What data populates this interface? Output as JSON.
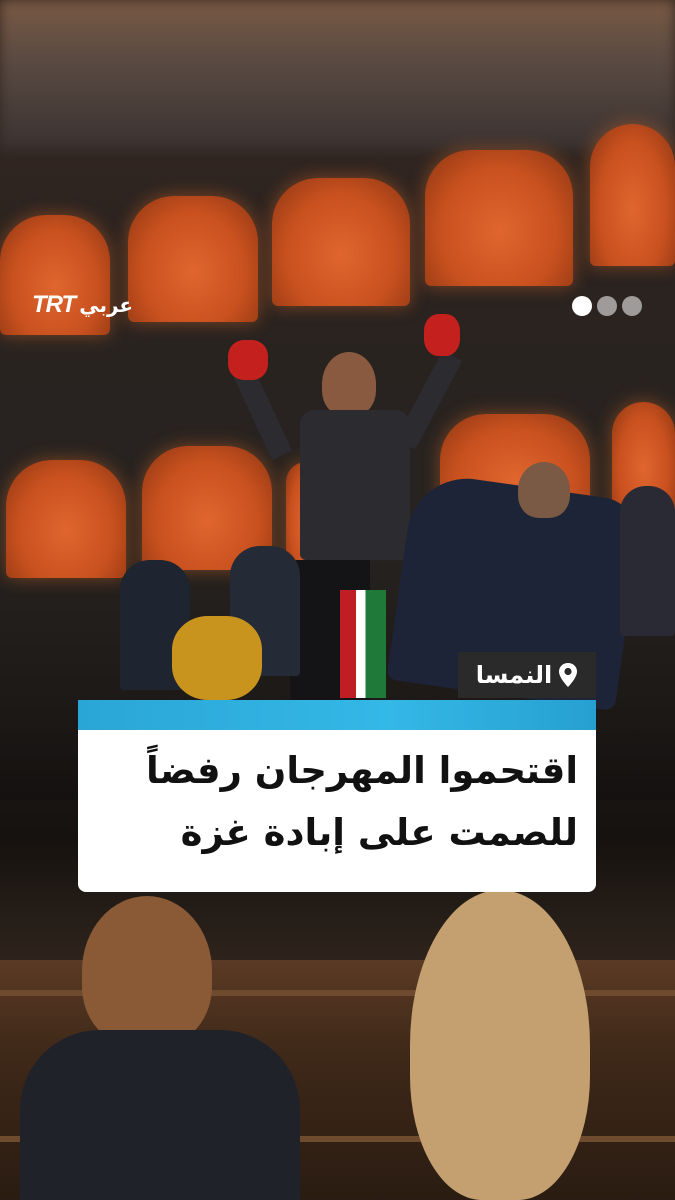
{
  "brand": {
    "name": "TRTعربي",
    "logo_latin": "TRT",
    "logo_arabic": "عربي"
  },
  "carousel": {
    "slides": 3,
    "active_index": 0
  },
  "location": {
    "icon": "map-pin-icon",
    "label": "النمسا"
  },
  "headline": {
    "line1": "اقتحموا المهرجان رفضاً",
    "line2": "للصمت على إبادة غزة"
  },
  "colors": {
    "accent_bar": "#2aa6d6",
    "caption_bg": "#ffffff",
    "location_bg": "#2a2a2a",
    "stage_arches": "#d4581f"
  }
}
